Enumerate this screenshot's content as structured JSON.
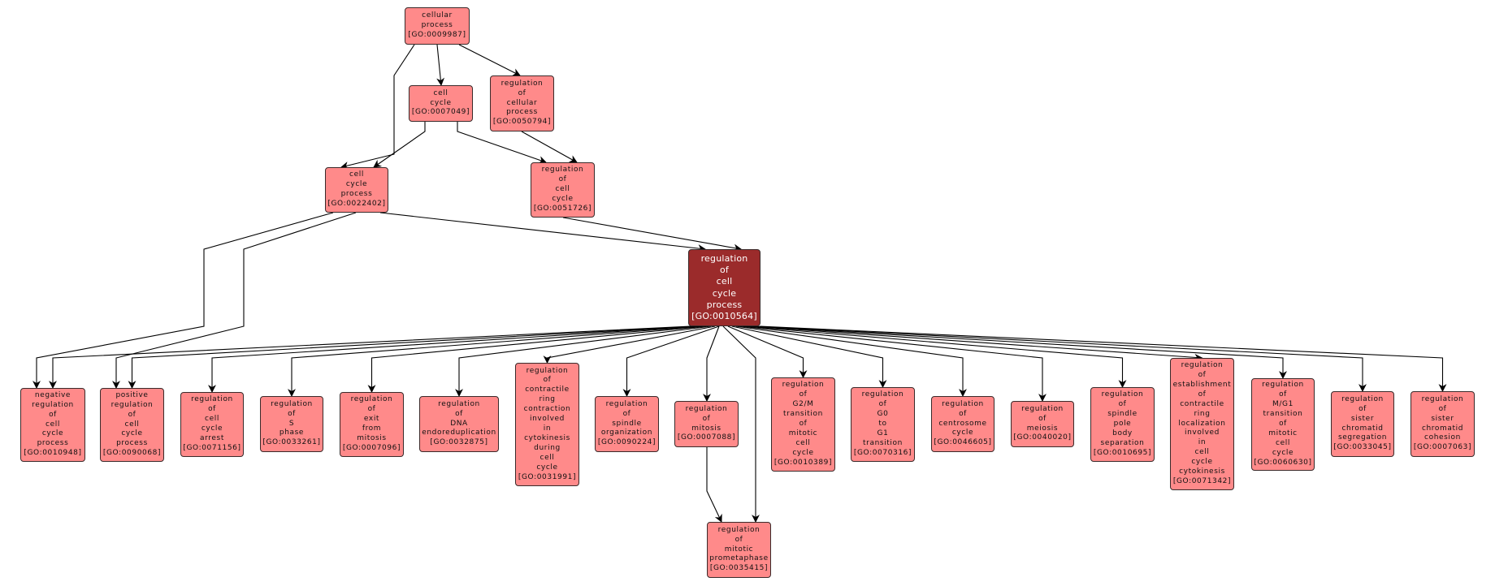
{
  "graph": {
    "colors": {
      "node_fill": "#ff8a8a",
      "focus_fill": "#9b2b2b",
      "edge": "#000000"
    },
    "nodes": [
      {
        "id": "GO:0009987",
        "lines": [
          "cellular",
          "process",
          "[GO:0009987]"
        ]
      },
      {
        "id": "GO:0007049",
        "lines": [
          "cell",
          "cycle",
          "[GO:0007049]"
        ]
      },
      {
        "id": "GO:0050794",
        "lines": [
          "regulation",
          "of",
          "cellular",
          "process",
          "[GO:0050794]"
        ]
      },
      {
        "id": "GO:0022402",
        "lines": [
          "cell",
          "cycle",
          "process",
          "[GO:0022402]"
        ]
      },
      {
        "id": "GO:0051726",
        "lines": [
          "regulation",
          "of",
          "cell",
          "cycle",
          "[GO:0051726]"
        ]
      },
      {
        "id": "GO:0010564",
        "focus": true,
        "lines": [
          "regulation",
          "of",
          "cell",
          "cycle",
          "process",
          "[GO:0010564]"
        ]
      },
      {
        "id": "GO:0010948",
        "lines": [
          "negative",
          "regulation",
          "of",
          "cell",
          "cycle",
          "process",
          "[GO:0010948]"
        ]
      },
      {
        "id": "GO:0090068",
        "lines": [
          "positive",
          "regulation",
          "of",
          "cell",
          "cycle",
          "process",
          "[GO:0090068]"
        ]
      },
      {
        "id": "GO:0071156",
        "lines": [
          "regulation",
          "of",
          "cell",
          "cycle",
          "arrest",
          "[GO:0071156]"
        ]
      },
      {
        "id": "GO:0033261",
        "lines": [
          "regulation",
          "of",
          "S",
          "phase",
          "[GO:0033261]"
        ]
      },
      {
        "id": "GO:0007096",
        "lines": [
          "regulation",
          "of",
          "exit",
          "from",
          "mitosis",
          "[GO:0007096]"
        ]
      },
      {
        "id": "GO:0032875",
        "lines": [
          "regulation",
          "of",
          "DNA",
          "endoreduplication",
          "[GO:0032875]"
        ]
      },
      {
        "id": "GO:0031991",
        "lines": [
          "regulation",
          "of",
          "contractile",
          "ring",
          "contraction",
          "involved",
          "in",
          "cytokinesis",
          "during",
          "cell",
          "cycle",
          "[GO:0031991]"
        ]
      },
      {
        "id": "GO:0090224",
        "lines": [
          "regulation",
          "of",
          "spindle",
          "organization",
          "[GO:0090224]"
        ]
      },
      {
        "id": "GO:0007088",
        "lines": [
          "regulation",
          "of",
          "mitosis",
          "[GO:0007088]"
        ]
      },
      {
        "id": "GO:0035415",
        "lines": [
          "regulation",
          "of",
          "mitotic",
          "prometaphase",
          "[GO:0035415]"
        ]
      },
      {
        "id": "GO:0010389",
        "lines": [
          "regulation",
          "of",
          "G2/M",
          "transition",
          "of",
          "mitotic",
          "cell",
          "cycle",
          "[GO:0010389]"
        ]
      },
      {
        "id": "GO:0070316",
        "lines": [
          "regulation",
          "of",
          "G0",
          "to",
          "G1",
          "transition",
          "[GO:0070316]"
        ]
      },
      {
        "id": "GO:0046605",
        "lines": [
          "regulation",
          "of",
          "centrosome",
          "cycle",
          "[GO:0046605]"
        ]
      },
      {
        "id": "GO:0040020",
        "lines": [
          "regulation",
          "of",
          "meiosis",
          "[GO:0040020]"
        ]
      },
      {
        "id": "GO:0010695",
        "lines": [
          "regulation",
          "of",
          "spindle",
          "pole",
          "body",
          "separation",
          "[GO:0010695]"
        ]
      },
      {
        "id": "GO:0071342",
        "lines": [
          "regulation",
          "of",
          "establishment",
          "of",
          "contractile",
          "ring",
          "localization",
          "involved",
          "in",
          "cell",
          "cycle",
          "cytokinesis",
          "[GO:0071342]"
        ]
      },
      {
        "id": "GO:0060630",
        "lines": [
          "regulation",
          "of",
          "M/G1",
          "transition",
          "of",
          "mitotic",
          "cell",
          "cycle",
          "[GO:0060630]"
        ]
      },
      {
        "id": "GO:0033045",
        "lines": [
          "regulation",
          "of",
          "sister",
          "chromatid",
          "segregation",
          "[GO:0033045]"
        ]
      },
      {
        "id": "GO:0007063",
        "lines": [
          "regulation",
          "of",
          "sister",
          "chromatid",
          "cohesion",
          "[GO:0007063]"
        ]
      }
    ],
    "edges": [
      [
        "GO:0009987",
        "GO:0007049"
      ],
      [
        "GO:0009987",
        "GO:0050794"
      ],
      [
        "GO:0009987",
        "GO:0022402"
      ],
      [
        "GO:0007049",
        "GO:0022402"
      ],
      [
        "GO:0007049",
        "GO:0051726"
      ],
      [
        "GO:0050794",
        "GO:0051726"
      ],
      [
        "GO:0022402",
        "GO:0010564"
      ],
      [
        "GO:0051726",
        "GO:0010564"
      ],
      [
        "GO:0022402",
        "GO:0010948"
      ],
      [
        "GO:0022402",
        "GO:0090068"
      ],
      [
        "GO:0010564",
        "GO:0010948"
      ],
      [
        "GO:0010564",
        "GO:0090068"
      ],
      [
        "GO:0010564",
        "GO:0071156"
      ],
      [
        "GO:0010564",
        "GO:0033261"
      ],
      [
        "GO:0010564",
        "GO:0007096"
      ],
      [
        "GO:0010564",
        "GO:0032875"
      ],
      [
        "GO:0010564",
        "GO:0031991"
      ],
      [
        "GO:0010564",
        "GO:0090224"
      ],
      [
        "GO:0010564",
        "GO:0007088"
      ],
      [
        "GO:0010564",
        "GO:0035415"
      ],
      [
        "GO:0007088",
        "GO:0035415"
      ],
      [
        "GO:0010564",
        "GO:0010389"
      ],
      [
        "GO:0010564",
        "GO:0070316"
      ],
      [
        "GO:0010564",
        "GO:0046605"
      ],
      [
        "GO:0010564",
        "GO:0040020"
      ],
      [
        "GO:0010564",
        "GO:0010695"
      ],
      [
        "GO:0010564",
        "GO:0071342"
      ],
      [
        "GO:0010564",
        "GO:0060630"
      ],
      [
        "GO:0010564",
        "GO:0033045"
      ],
      [
        "GO:0010564",
        "GO:0007063"
      ]
    ]
  }
}
